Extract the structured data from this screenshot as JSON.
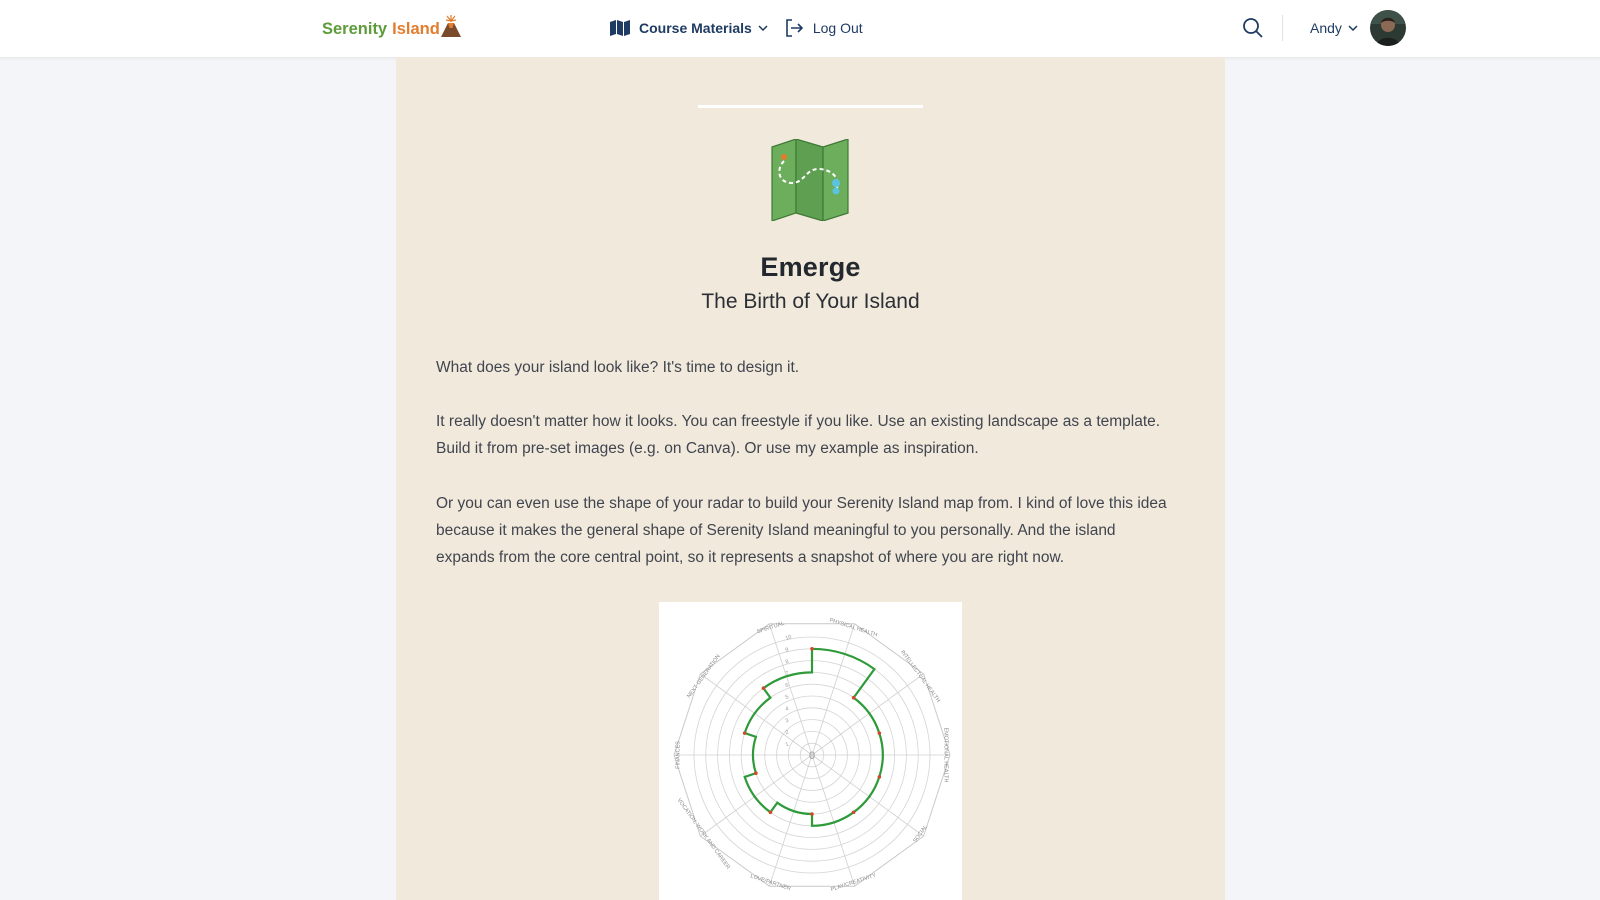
{
  "header": {
    "brand_word1": "Serenity",
    "brand_word2": "Island",
    "nav": {
      "course_materials": "Course Materials",
      "log_out": "Log Out"
    },
    "user_name": "Andy"
  },
  "icons": {
    "course_materials": "map-icon",
    "log_out": "logout-icon",
    "search": "search-icon",
    "dropdown": "chevron-down-icon",
    "lesson": "treasure-map-icon"
  },
  "colors": {
    "brand_green": "#5e9b3a",
    "brand_orange": "#e27d2e",
    "nav_text": "#1f3b63",
    "card_bg": "#f1e9db",
    "radar_line": "#2e9a3a"
  },
  "lesson": {
    "title": "Emerge",
    "subtitle": "The Birth of Your Island",
    "paragraphs": [
      "What does your island look like? It's time to design it.",
      "It really doesn't matter how it looks. You can freestyle if you like. Use an existing landscape as a template. Build it from pre-set images (e.g. on Canva). Or use my example as inspiration.",
      "Or you can even use the shape of your radar to build your Serenity Island map from. I kind of love this idea because it makes the general shape of Serenity Island meaningful to you personally. And the island expands from the core central point, so it represents a snapshot of where you are right now."
    ]
  },
  "chart_data": {
    "type": "radar",
    "center_label": "0",
    "rmax": 10,
    "rings": [
      1,
      2,
      3,
      4,
      5,
      6,
      7,
      8,
      9,
      10
    ],
    "tick_labels": [
      "1",
      "2",
      "3",
      "4",
      "5",
      "6",
      "7",
      "8",
      "9",
      "10"
    ],
    "categories": [
      "PHYSICAL HEALTH",
      "INTELLECTUAL HEALTH",
      "EMOTIONAL HEALTH",
      "SOCIAL",
      "PLAY/CREATIVITY",
      "LOVE/PARTNER",
      "VOCATION, WORK AND CAREER",
      "FINANCES",
      "NEXT GENERATION",
      "SPIRITUAL"
    ],
    "values": [
      9,
      6,
      6,
      6,
      6,
      5,
      6,
      5,
      6,
      7
    ],
    "grid": true
  }
}
